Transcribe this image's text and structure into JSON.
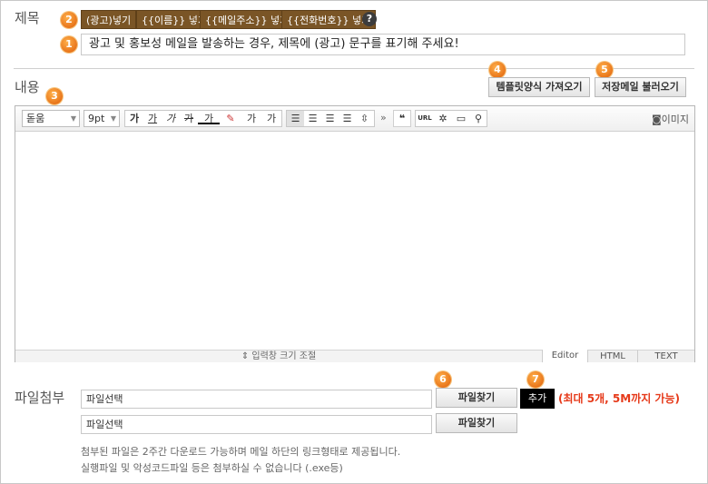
{
  "subject": {
    "label": "제목",
    "tags": [
      "(광고)넣기",
      "{{이름}} 넣기",
      "{{메일주소}} 넣기",
      "{{전화번호}} 넣기"
    ],
    "help": "?",
    "value": "광고 및 홍보성 메일을 발송하는 경우, 제목에 (광고) 문구를 표기해 주세요!"
  },
  "content": {
    "label": "내용",
    "template_button": "템플릿양식 가져오기",
    "saved_button": "저장메일 불러오기"
  },
  "toolbar": {
    "font": "돋움",
    "size": "9pt",
    "bold": "가",
    "underline": "가",
    "italic": "가",
    "strike": "가",
    "fontcolor": "가",
    "superscript": "가",
    "subscript": "가",
    "more": "»",
    "quote": "❝",
    "url": "URL",
    "image_label": "이미지"
  },
  "editor": {
    "resize": "⇕ 입력창 크기 조절",
    "modes": [
      "Editor",
      "HTML",
      "TEXT"
    ]
  },
  "attach": {
    "label": "파일첨부",
    "file1": "파일선택",
    "file2": "파일선택",
    "find": "파일찾기",
    "add": "추가",
    "limit": "(최대 5개, 5M까지 가능)",
    "note1": "첨부된 파일은 2주간 다운로드 가능하며 메일 하단의 링크형태로 제공됩니다.",
    "note2": "실행파일 및 악성코드파일 등은 첨부하실 수 없습니다 (.exe등)"
  },
  "badges": [
    "1",
    "2",
    "3",
    "4",
    "5",
    "6",
    "7"
  ],
  "colors": {
    "tag_bg": "#7a5526",
    "badge": "#f08a24",
    "limit_text": "#e63a1a"
  }
}
